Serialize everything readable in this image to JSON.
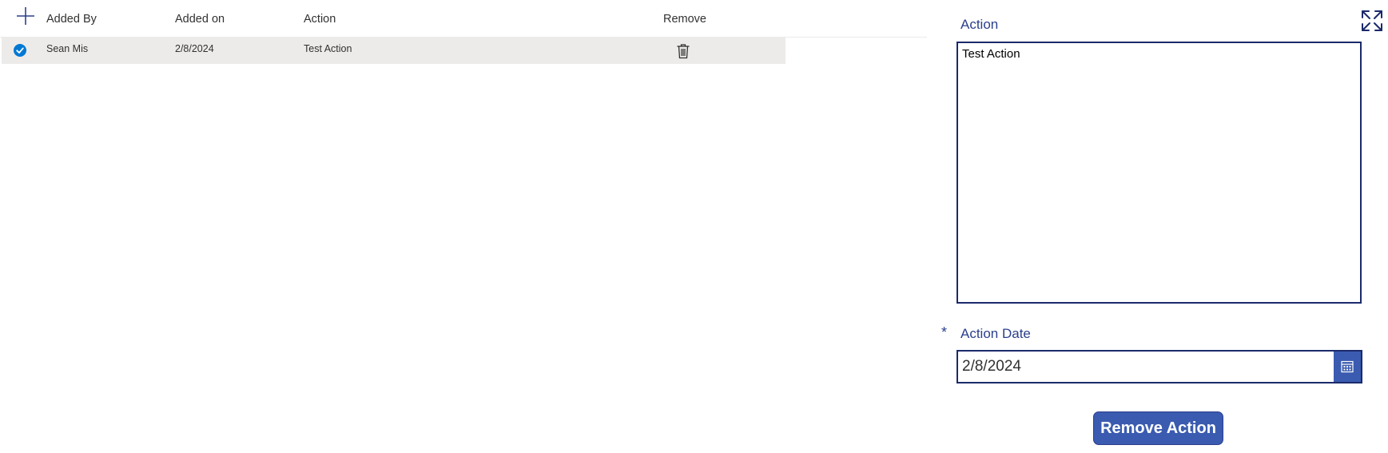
{
  "gallery": {
    "add_icon": "plus-icon",
    "columns": {
      "added_by": "Added By",
      "added_on": "Added on",
      "action": "Action",
      "remove": "Remove"
    },
    "rows": [
      {
        "selected": true,
        "added_by": "Sean Mis",
        "added_on": "2/8/2024",
        "action": "Test Action",
        "remove_icon": "trash-icon"
      }
    ]
  },
  "form": {
    "expand_icon": "expand-icon",
    "action_label": "Action",
    "action_value": "Test Action",
    "date_required_marker": "*",
    "date_label": "Action Date",
    "date_value": "2/8/2024",
    "calendar_icon": "calendar-icon",
    "remove_button_label": "Remove Action"
  },
  "colors": {
    "accent": "#3a5bb0",
    "border": "#1b2a6b",
    "label": "#2b3f8c",
    "row_selected": "#edebe9",
    "check": "#0078d4"
  }
}
